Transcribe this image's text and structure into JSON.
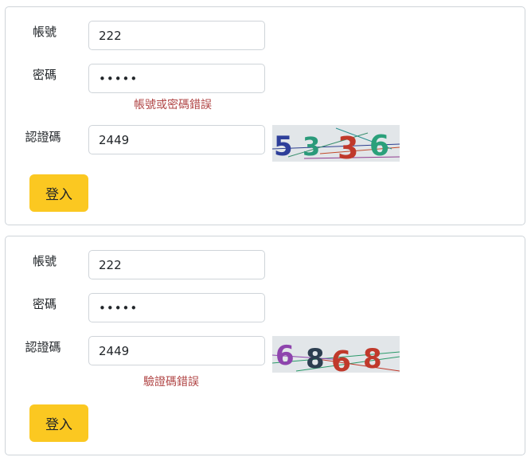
{
  "form1": {
    "account_label": "帳號",
    "account_value": "222",
    "password_label": "密碼",
    "password_value": "•••••",
    "error_text": "帳號或密碼錯誤",
    "captcha_label": "認證碼",
    "captcha_value": "2449",
    "captcha_digits": [
      "5",
      "3",
      "3",
      "6"
    ],
    "login_label": "登入"
  },
  "form2": {
    "account_label": "帳號",
    "account_value": "222",
    "password_label": "密碼",
    "password_value": "•••••",
    "captcha_label": "認證碼",
    "captcha_value": "2449",
    "captcha_digits": [
      "6",
      "8",
      "6",
      "8"
    ],
    "error_text": "驗證碼錯誤",
    "login_label": "登入"
  },
  "colors": {
    "button": "#fbc821",
    "error": "#b04545",
    "border": "#cfd4d9"
  }
}
